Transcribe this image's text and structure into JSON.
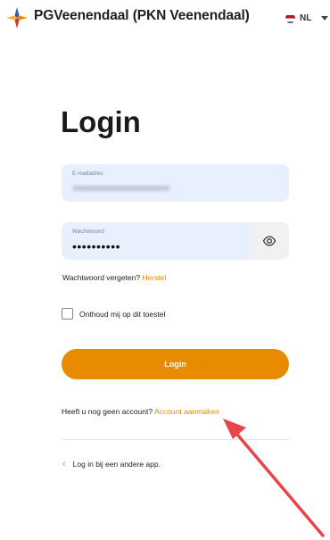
{
  "header": {
    "app_title": "PGVeenendaal (PKN Veenendaal)",
    "language": "NL"
  },
  "login": {
    "title": "Login",
    "email_label": "E-mailadres",
    "password_label": "Wachtwoord",
    "password_value": "••••••••••",
    "forgot_text": "Wachtwoord vergeten?",
    "forgot_link": "Herstel",
    "remember_label": "Onthoud mij op dit toestel",
    "submit_label": "Login",
    "signup_text": "Heeft u nog geen account?",
    "signup_link": "Account aanmaken",
    "other_app_label": "Log in bij een andere app."
  },
  "colors": {
    "accent": "#e98b00",
    "input_bg": "#e8f0fe",
    "annotation_arrow": "#e8454a"
  }
}
